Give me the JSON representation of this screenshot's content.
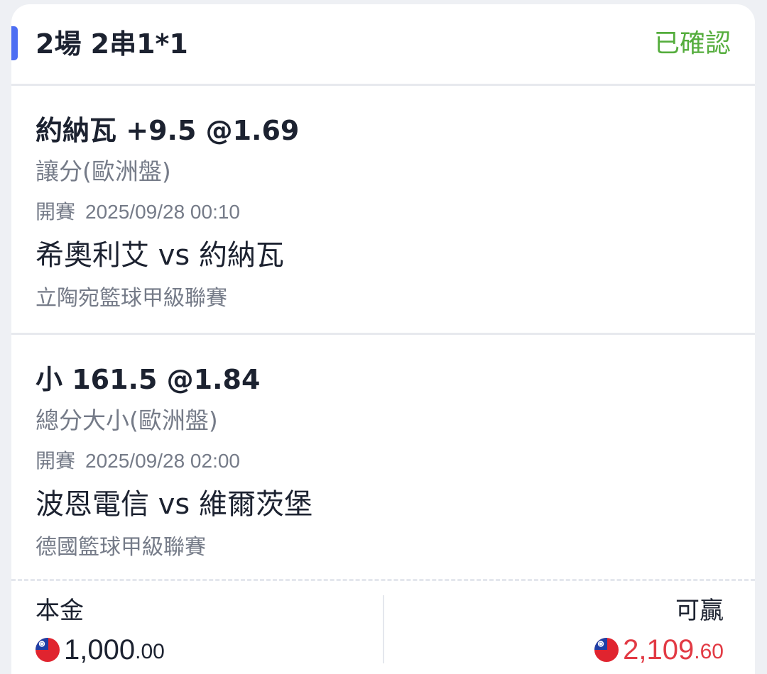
{
  "header": {
    "title": "2場 2串1*1",
    "status": "已確認"
  },
  "bets": [
    {
      "pick": "約納瓦 +9.5 @1.69",
      "market": "讓分(歐洲盤)",
      "start_label": "開賽",
      "start_time": "2025/09/28 00:10",
      "match": "希奧利艾 vs 約納瓦",
      "league": "立陶宛籃球甲級聯賽"
    },
    {
      "pick": "小 161.5 @1.84",
      "market": "總分大小(歐洲盤)",
      "start_label": "開賽",
      "start_time": "2025/09/28 02:00",
      "match": "波恩電信 vs 維爾茨堡",
      "league": "德國籃球甲級聯賽"
    }
  ],
  "footer": {
    "principal_label": "本金",
    "principal_main": "1,000",
    "principal_decimal": ".00",
    "winnable_label": "可贏",
    "winnable_main": "2,109",
    "winnable_decimal": ".60",
    "currency_icon": "taiwan-flag-icon"
  },
  "colors": {
    "accent": "#4d6ef3",
    "status_confirmed": "#55ad3d",
    "winnable": "#e23a44",
    "secondary_text": "#757b88"
  }
}
